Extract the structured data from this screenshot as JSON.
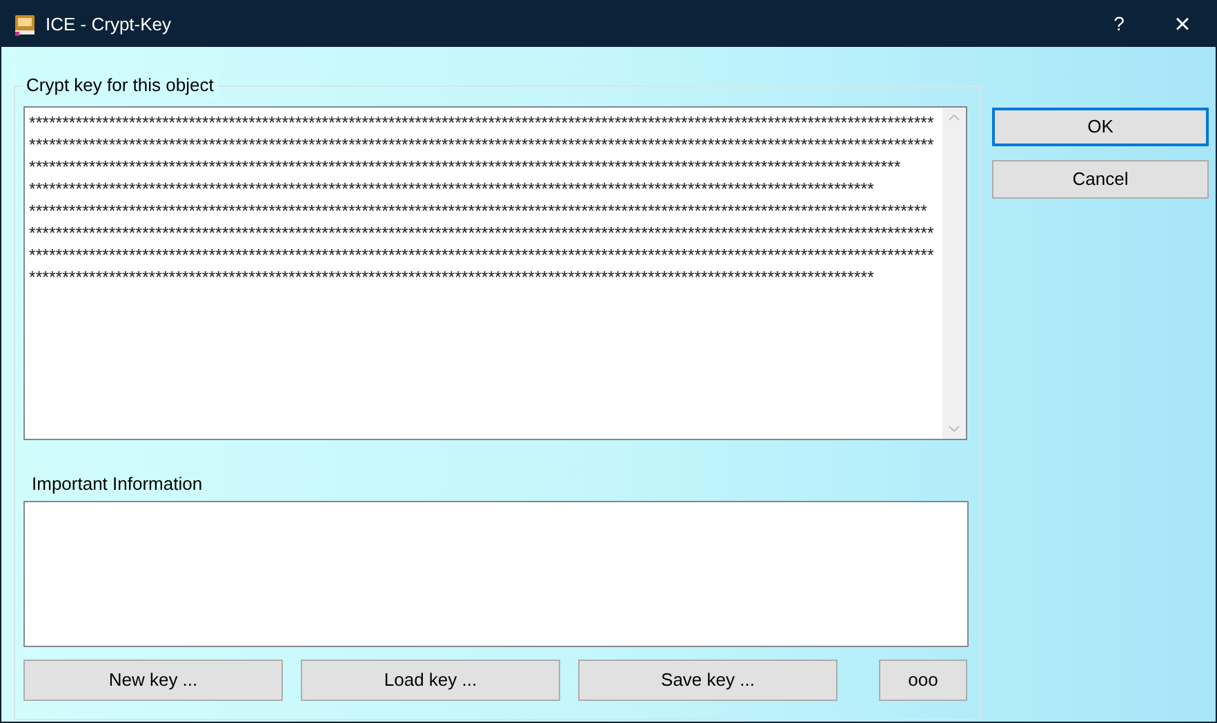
{
  "window": {
    "title": "ICE - Crypt-Key",
    "help": "?",
    "close": "×"
  },
  "key_group": {
    "label": "Crypt key for this object",
    "text": "****************************************************************************************************************************************\n****************************************************************************************************************************************\n***********************************************************************************************************************************\n*******************************************************************************************************************************\n***************************************************************************************************************************************\n****************************************************************************************************************************************\n****************************************************************************************************************************************\n*******************************************************************************************************************************"
  },
  "info": {
    "label": "Important Information"
  },
  "key_buttons": [
    "New key ...",
    "Load key ...",
    "Save key ...",
    "ooo"
  ],
  "dialog_buttons": [
    {
      "label": "OK",
      "default": true
    },
    {
      "label": "Cancel",
      "default": false
    }
  ]
}
